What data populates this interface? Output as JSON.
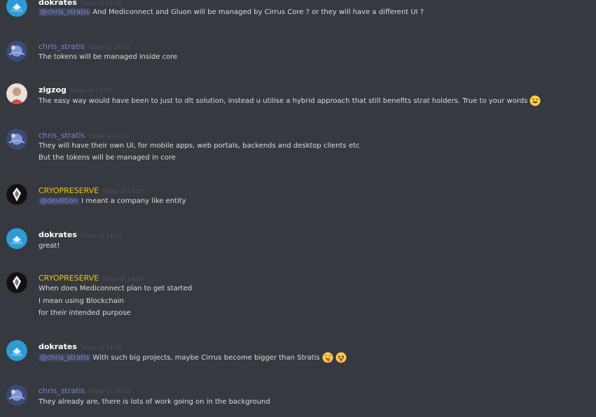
{
  "colors": {
    "background": "#36393f",
    "text": "#dcddde",
    "mention": "#7289da",
    "username_blue": "#7289da",
    "username_gold": "#f1c40f",
    "timestamp": "#4f5258"
  },
  "messages": [
    {
      "author": "dokrates",
      "timestamp": "Today at 14:56",
      "avatar_icon": "stratis-logo-avatar",
      "mention": "@chris_stratis",
      "lines": [
        "And Mediconnect and Gluon will be managed by Cirrus Core ? or they will have a different UI ?"
      ]
    },
    {
      "author": "chris_stratis",
      "timestamp": "Today at 14:56",
      "avatar_icon": "space-avatar",
      "lines": [
        "The tokens will be managed inside core"
      ]
    },
    {
      "author": "zigzog",
      "timestamp": "Today at 14:56",
      "avatar_icon": "person-avatar",
      "lines": [
        "The easy way would have been to just to dlt solution, instead u utilise a hybrid approach that still benefits strat holders. True to your words"
      ],
      "emoji": "grinning-emoji"
    },
    {
      "author": "chris_stratis",
      "timestamp": "Today at 14:57",
      "avatar_icon": "space-avatar",
      "lines": [
        "They will have their own UI, for mobile apps, web portals, backends and desktop clients etc",
        "But the tokens will be managed in core"
      ]
    },
    {
      "author": "CRYOPRESERVE",
      "timestamp": "Today at 14:57",
      "avatar_icon": "cryopreserve-avatar",
      "mention": "@dev0tion",
      "lines": [
        "I meant a company like entity"
      ]
    },
    {
      "author": "dokrates",
      "timestamp": "Today at 14:57",
      "avatar_icon": "stratis-logo-avatar",
      "lines": [
        "great!"
      ]
    },
    {
      "author": "CRYOPRESERVE",
      "timestamp": "Today at 14:58",
      "avatar_icon": "cryopreserve-avatar",
      "lines": [
        "When does Mediconnect plan to get started",
        "I mean using Blockchain",
        "for their intended purpose"
      ]
    },
    {
      "author": "dokrates",
      "timestamp": "Today at 14:58",
      "avatar_icon": "stratis-logo-avatar",
      "mention": "@chris_stratis",
      "lines": [
        "With such big projects, maybe Cirrus become bigger than Stratis"
      ],
      "emoji": "tongue-emoji"
    },
    {
      "author": "chris_stratis",
      "timestamp": "Today at 14:58",
      "avatar_icon": "space-avatar",
      "lines": [
        "They already are, there is lots of work going on in the background"
      ]
    }
  ]
}
